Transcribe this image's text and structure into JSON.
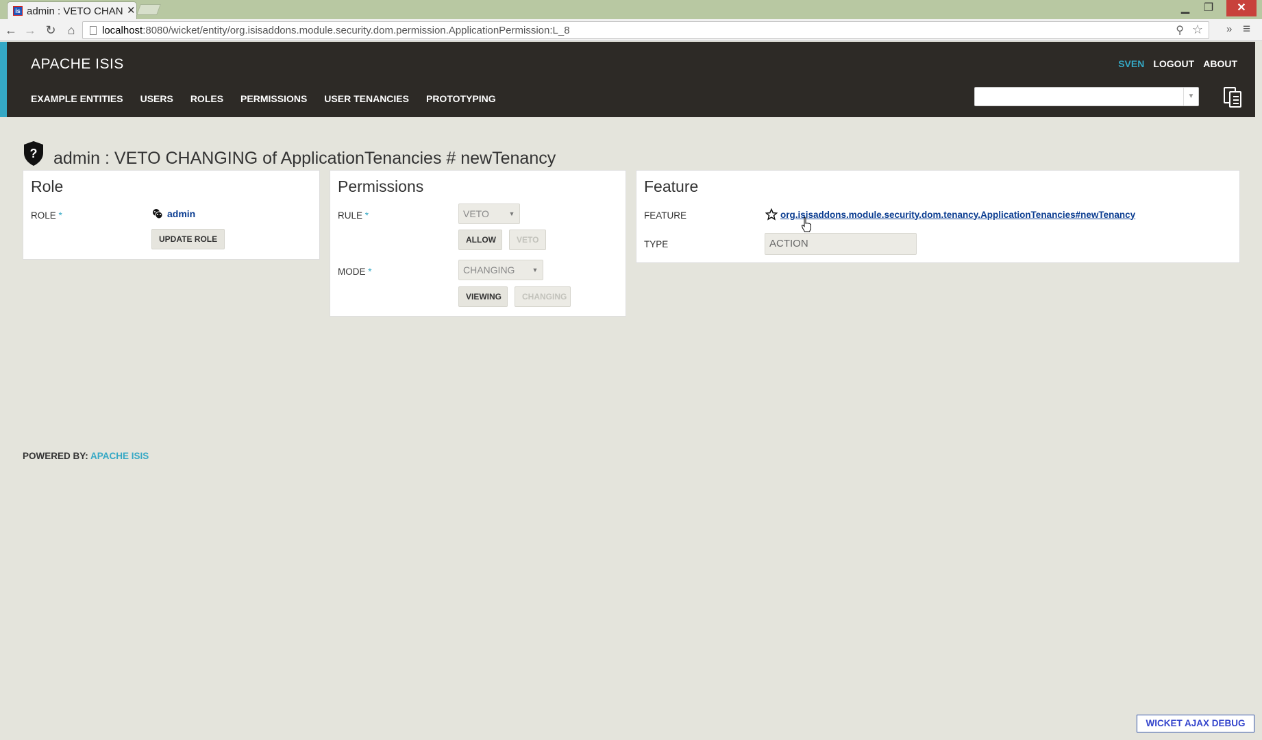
{
  "browser": {
    "tab_title": "admin : VETO CHAN(",
    "tab_favicon_letter": "is",
    "url_host": "localhost",
    "url_rest": ":8080/wicket/entity/org.isisaddons.module.security.dom.permission.ApplicationPermission:L_8"
  },
  "header": {
    "brand": "APACHE ISIS",
    "nav": [
      "EXAMPLE ENTITIES",
      "USERS",
      "ROLES",
      "PERMISSIONS",
      "USER TENANCIES",
      "PROTOTYPING"
    ],
    "user_links": {
      "user": "SVEN",
      "logout": "LOGOUT",
      "about": "ABOUT"
    },
    "search_value": "",
    "accent_color": "#35a8c5"
  },
  "page": {
    "title": "admin : VETO CHANGING of ApplicationTenancies # newTenancy"
  },
  "role_panel": {
    "title": "Role",
    "role_label": "ROLE",
    "role_value": "admin",
    "update_button": "UPDATE ROLE"
  },
  "permissions_panel": {
    "title": "Permissions",
    "rule_label": "RULE",
    "rule_value": "VETO",
    "allow_button": "ALLOW",
    "veto_button": "VETO",
    "mode_label": "MODE",
    "mode_value": "CHANGING",
    "viewing_button": "VIEWING",
    "changing_button": "CHANGING"
  },
  "feature_panel": {
    "title": "Feature",
    "feature_label": "FEATURE",
    "feature_value": "org.isisaddons.module.security.dom.tenancy.ApplicationTenancies#newTenancy",
    "type_label": "TYPE",
    "type_value": "ACTION"
  },
  "footer": {
    "powered_by": "POWERED BY:",
    "powered_link": "APACHE ISIS",
    "debug_button": "WICKET AJAX DEBUG"
  },
  "required_marker": "*"
}
